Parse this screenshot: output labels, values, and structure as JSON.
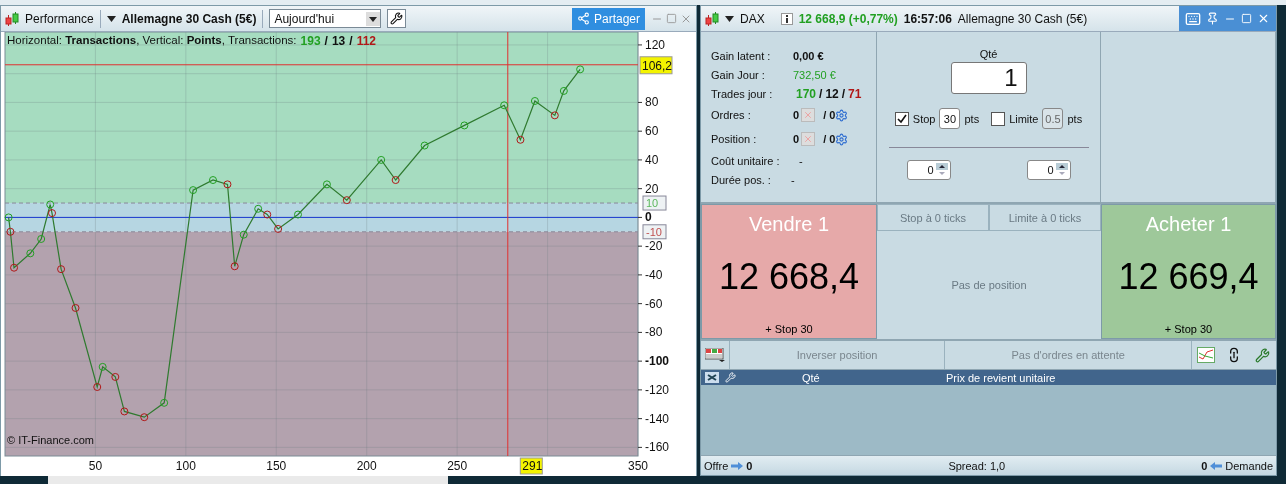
{
  "chart_window": {
    "title": "Performance",
    "instrument": "Allemagne 30 Cash (5€)",
    "period": "Aujourd'hui",
    "share_button": "Partager",
    "caption": "Horizontal: **Transactions**, Vertical: **Points**, Transactions:",
    "caption_counts": [
      {
        "text": "193",
        "color": "#22a022"
      },
      {
        "text": "/",
        "color": "#111111"
      },
      {
        "text": "13",
        "color": "#111111"
      },
      {
        "text": "/",
        "color": "#111111"
      },
      {
        "text": "112",
        "color": "#b01818"
      }
    ],
    "copyright": "© IT-Finance.com",
    "cursor_label": "291",
    "chart_data": {
      "type": "line",
      "xlim": [
        0,
        350
      ],
      "ylim": [
        -166,
        129
      ],
      "grid": true,
      "xticks": [
        50,
        100,
        150,
        200,
        250,
        350
      ],
      "yticks": [
        120,
        80,
        60,
        40,
        20,
        0,
        -20,
        -40,
        -60,
        -80,
        -100,
        -120,
        -140,
        -160
      ],
      "bands": [
        {
          "axis": "y",
          "from": 10,
          "to": 129,
          "color": "#a6dcc0"
        },
        {
          "axis": "y",
          "from": -10,
          "to": 10,
          "color": "#b6d6e2"
        },
        {
          "axis": "y",
          "from": -166,
          "to": -10,
          "color": "#b3a2ae"
        }
      ],
      "ref_lines": [
        {
          "axis": "y",
          "value": 10,
          "label": "10",
          "color": "#888899"
        },
        {
          "axis": "y",
          "value": -10,
          "label": "-10",
          "color": "#888899"
        },
        {
          "axis": "y",
          "value": 0,
          "color": "#1a3ad0"
        },
        {
          "axis": "y",
          "value": 106.2,
          "label": "106,2",
          "color": "#e03030"
        },
        {
          "axis": "x",
          "value": 278,
          "color": "#e03030"
        }
      ],
      "x": [
        2,
        3,
        5,
        14,
        20,
        25,
        26,
        31,
        39,
        51,
        54,
        61,
        66,
        77,
        88,
        104,
        115,
        123,
        127,
        132,
        140,
        145,
        151,
        162,
        178,
        189,
        208,
        216,
        232,
        254,
        276,
        285,
        293,
        304,
        309,
        318
      ],
      "series": [
        {
          "color": "#2f7a2f",
          "marker": "o",
          "values": [
            0,
            -10,
            -35,
            -25,
            -15,
            9,
            3,
            -36,
            -63,
            -118,
            -104,
            -111,
            -135,
            -139,
            -129,
            19,
            26,
            23,
            -34,
            -12,
            6,
            2,
            -8,
            2,
            23,
            12,
            40,
            26,
            50,
            64,
            78,
            54,
            81,
            71,
            88,
            103
          ]
        }
      ]
    }
  },
  "trade_window": {
    "symbol": "DAX",
    "quote": "12 668,9 (+0,77%)",
    "time": "16:57:06",
    "instrument": "Allemagne 30 Cash (5€)",
    "account": [
      {
        "kind": "value",
        "label": "Gain latent :",
        "value": "0,00 €",
        "color": "#111111"
      },
      {
        "kind": "value",
        "label": "Gain Jour :",
        "value": "732,50 €",
        "color": "#22a022"
      },
      {
        "kind": "counts",
        "label": "Trades jour :",
        "counts": [
          {
            "text": "170",
            "color": "#22a022"
          },
          {
            "text": "/",
            "color": "#111111"
          },
          {
            "text": "12",
            "color": "#111111"
          },
          {
            "text": "/",
            "color": "#111111"
          },
          {
            "text": "71",
            "color": "#b01818"
          }
        ]
      },
      {
        "kind": "orders",
        "label": "Ordres :",
        "first": "0",
        "second": "/ 0"
      },
      {
        "kind": "orders",
        "label": "Position :",
        "first": "0",
        "second": "/ 0"
      },
      {
        "kind": "plain",
        "label": "Coût unitaire :",
        "value": "-"
      },
      {
        "kind": "plain",
        "label": "Durée pos. :",
        "value": "-"
      }
    ],
    "quantity": {
      "label": "Qté",
      "value": "1"
    },
    "stop": {
      "label": "Stop",
      "checked": true,
      "value": "30",
      "disabled": false,
      "unit": "pts"
    },
    "limit": {
      "label": "Limite",
      "checked": false,
      "value": "0.5",
      "disabled": true,
      "unit": "pts"
    },
    "spinners": [
      "0",
      "0"
    ],
    "sell": {
      "title": "Vendre 1",
      "price": "12 668,4",
      "note": "+ Stop 30"
    },
    "buy": {
      "title": "Acheter 1",
      "price": "12 669,4",
      "note": "+ Stop 30"
    },
    "offset_buttons": [
      "Stop à 0 ticks",
      "Limite à 0 ticks"
    ],
    "position_status": "Pas de position",
    "toolbar_buttons": [
      "Inverser position",
      "Pas d'ordres en attente"
    ],
    "table_columns": [
      "Qté",
      "Prix de revient unitaire"
    ],
    "status_bar": {
      "offer_label": "Offre",
      "offer_value": "0",
      "spread_label": "Spread:",
      "spread_value": "1,0",
      "demand_value": "0",
      "demand_label": "Demande"
    }
  }
}
